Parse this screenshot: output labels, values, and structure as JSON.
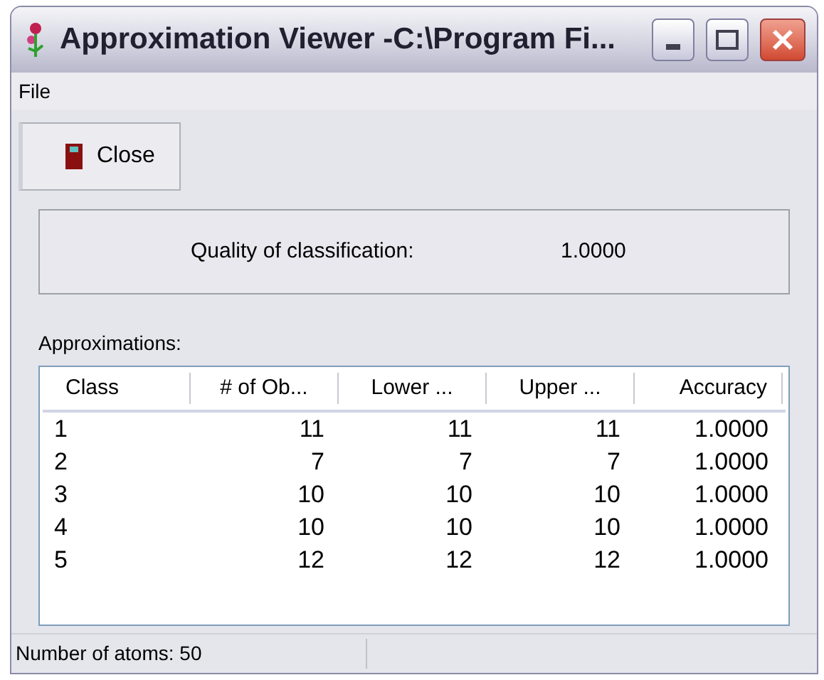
{
  "window": {
    "title": "Approximation Viewer -C:\\Program Fi..."
  },
  "menu": [
    "File"
  ],
  "toolbar": {
    "close_button": "Close"
  },
  "quality": {
    "label": "Quality of classification:",
    "value": "1.0000"
  },
  "approximations": {
    "label": "Approximations:",
    "columns": [
      "Class",
      "# of Ob...",
      "Lower ...",
      "Upper ...",
      "Accuracy"
    ],
    "rows": [
      [
        "1",
        "11",
        "11",
        "11",
        "1.0000"
      ],
      [
        "2",
        "7",
        "7",
        "7",
        "1.0000"
      ],
      [
        "3",
        "10",
        "10",
        "10",
        "1.0000"
      ],
      [
        "4",
        "10",
        "10",
        "10",
        "1.0000"
      ],
      [
        "5",
        "12",
        "12",
        "12",
        "1.0000"
      ]
    ]
  },
  "status_bar": "Number of atoms: 50"
}
